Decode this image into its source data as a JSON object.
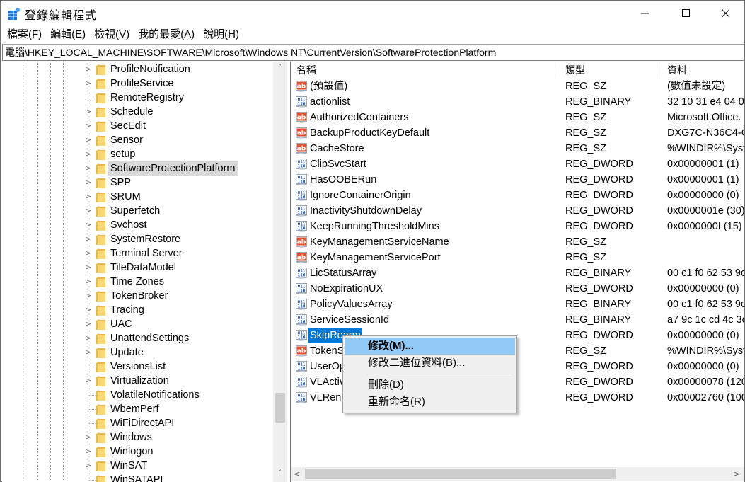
{
  "window": {
    "title": "登錄編輯程式",
    "icon": "registry-editor-icon",
    "controls": {
      "minimize": "—",
      "maximize": "☐",
      "close": "✕"
    }
  },
  "menu": [
    {
      "label": "檔案(F)"
    },
    {
      "label": "編輯(E)"
    },
    {
      "label": "檢視(V)"
    },
    {
      "label": "我的最愛(A)"
    },
    {
      "label": "說明(H)"
    }
  ],
  "address": "電腦\\HKEY_LOCAL_MACHINE\\SOFTWARE\\Microsoft\\Windows NT\\CurrentVersion\\SoftwareProtectionPlatform",
  "tree": {
    "items": [
      {
        "label": "ProfileNotification",
        "expandable": true,
        "selected": false
      },
      {
        "label": "ProfileService",
        "expandable": true,
        "selected": false
      },
      {
        "label": "RemoteRegistry",
        "expandable": false,
        "selected": false
      },
      {
        "label": "Schedule",
        "expandable": true,
        "selected": false
      },
      {
        "label": "SecEdit",
        "expandable": true,
        "selected": false
      },
      {
        "label": "Sensor",
        "expandable": true,
        "selected": false
      },
      {
        "label": "setup",
        "expandable": true,
        "selected": false
      },
      {
        "label": "SoftwareProtectionPlatform",
        "expandable": true,
        "selected": true
      },
      {
        "label": "SPP",
        "expandable": true,
        "selected": false
      },
      {
        "label": "SRUM",
        "expandable": true,
        "selected": false
      },
      {
        "label": "Superfetch",
        "expandable": true,
        "selected": false
      },
      {
        "label": "Svchost",
        "expandable": true,
        "selected": false
      },
      {
        "label": "SystemRestore",
        "expandable": true,
        "selected": false
      },
      {
        "label": "Terminal Server",
        "expandable": true,
        "selected": false
      },
      {
        "label": "TileDataModel",
        "expandable": true,
        "selected": false
      },
      {
        "label": "Time Zones",
        "expandable": true,
        "selected": false
      },
      {
        "label": "TokenBroker",
        "expandable": true,
        "selected": false
      },
      {
        "label": "Tracing",
        "expandable": true,
        "selected": false
      },
      {
        "label": "UAC",
        "expandable": true,
        "selected": false
      },
      {
        "label": "UnattendSettings",
        "expandable": true,
        "selected": false
      },
      {
        "label": "Update",
        "expandable": true,
        "selected": false
      },
      {
        "label": "VersionsList",
        "expandable": false,
        "selected": false
      },
      {
        "label": "Virtualization",
        "expandable": true,
        "selected": false
      },
      {
        "label": "VolatileNotifications",
        "expandable": false,
        "selected": false
      },
      {
        "label": "WbemPerf",
        "expandable": false,
        "selected": false
      },
      {
        "label": "WiFiDirectAPI",
        "expandable": false,
        "selected": false
      },
      {
        "label": "Windows",
        "expandable": true,
        "selected": false
      },
      {
        "label": "Winlogon",
        "expandable": true,
        "selected": false
      },
      {
        "label": "WinSAT",
        "expandable": true,
        "selected": false
      },
      {
        "label": "WinSATAPI",
        "expandable": false,
        "selected": false
      }
    ],
    "scroll_up": "˄",
    "scroll_down": "˅"
  },
  "list": {
    "columns": {
      "name": "名稱",
      "type": "類型",
      "data": "資料"
    },
    "rows": [
      {
        "icon": "string",
        "name": "(預設值)",
        "type": "REG_SZ",
        "data": "(數值未設定)"
      },
      {
        "icon": "binary",
        "name": "actionlist",
        "type": "REG_BINARY",
        "data": "32 10 31 e4 04 0"
      },
      {
        "icon": "string",
        "name": "AuthorizedContainers",
        "type": "REG_SZ",
        "data": "Microsoft.Office."
      },
      {
        "icon": "string",
        "name": "BackupProductKeyDefault",
        "type": "REG_SZ",
        "data": "DXG7C-N36C4-C"
      },
      {
        "icon": "string",
        "name": "CacheStore",
        "type": "REG_SZ",
        "data": "%WINDIR%\\Syst"
      },
      {
        "icon": "binary",
        "name": "ClipSvcStart",
        "type": "REG_DWORD",
        "data": "0x00000001 (1)"
      },
      {
        "icon": "binary",
        "name": "HasOOBERun",
        "type": "REG_DWORD",
        "data": "0x00000001 (1)"
      },
      {
        "icon": "binary",
        "name": "IgnoreContainerOrigin",
        "type": "REG_DWORD",
        "data": "0x00000000 (0)"
      },
      {
        "icon": "binary",
        "name": "InactivityShutdownDelay",
        "type": "REG_DWORD",
        "data": "0x0000001e (30)"
      },
      {
        "icon": "binary",
        "name": "KeepRunningThresholdMins",
        "type": "REG_DWORD",
        "data": "0x0000000f (15)"
      },
      {
        "icon": "string",
        "name": "KeyManagementServiceName",
        "type": "REG_SZ",
        "data": ""
      },
      {
        "icon": "string",
        "name": "KeyManagementServicePort",
        "type": "REG_SZ",
        "data": ""
      },
      {
        "icon": "binary",
        "name": "LicStatusArray",
        "type": "REG_BINARY",
        "data": "00 c1 f0 62 53 9c"
      },
      {
        "icon": "binary",
        "name": "NoExpirationUX",
        "type": "REG_DWORD",
        "data": "0x00000000 (0)"
      },
      {
        "icon": "binary",
        "name": "PolicyValuesArray",
        "type": "REG_BINARY",
        "data": "00 c1 f0 62 53 9c"
      },
      {
        "icon": "binary",
        "name": "ServiceSessionId",
        "type": "REG_BINARY",
        "data": "a7 9c 1c cd 4c 3c"
      },
      {
        "icon": "binary",
        "name": "SkipRearm",
        "type": "REG_DWORD",
        "data": "0x00000000 (0)",
        "selected": true
      },
      {
        "icon": "string",
        "name": "TokenS",
        "type": "REG_SZ",
        "data": "%WINDIR%\\Syst"
      },
      {
        "icon": "binary",
        "name": "UserOp",
        "type": "REG_DWORD",
        "data": "0x00000000 (0)"
      },
      {
        "icon": "binary",
        "name": "VLActiv",
        "type": "REG_DWORD",
        "data": "0x00000078 (120"
      },
      {
        "icon": "binary",
        "name": "VLRene",
        "type": "REG_DWORD",
        "data": "0x00002760 (100"
      }
    ],
    "scroll_left": "<",
    "scroll_right": ">"
  },
  "context_menu": {
    "items": [
      {
        "label": "修改(M)...",
        "bold": true,
        "hover": true
      },
      {
        "label": "修改二進位資料(B)...",
        "bold": false,
        "hover": false
      },
      {
        "separator": true
      },
      {
        "label": "刪除(D)",
        "bold": false,
        "hover": false
      },
      {
        "label": "重新命名(R)",
        "bold": false,
        "hover": false
      }
    ]
  },
  "colors": {
    "selection": "#0078d7",
    "tree_selection": "#d9d9d9",
    "menu_hover": "#91c9f7",
    "folder": "#f8d775"
  }
}
